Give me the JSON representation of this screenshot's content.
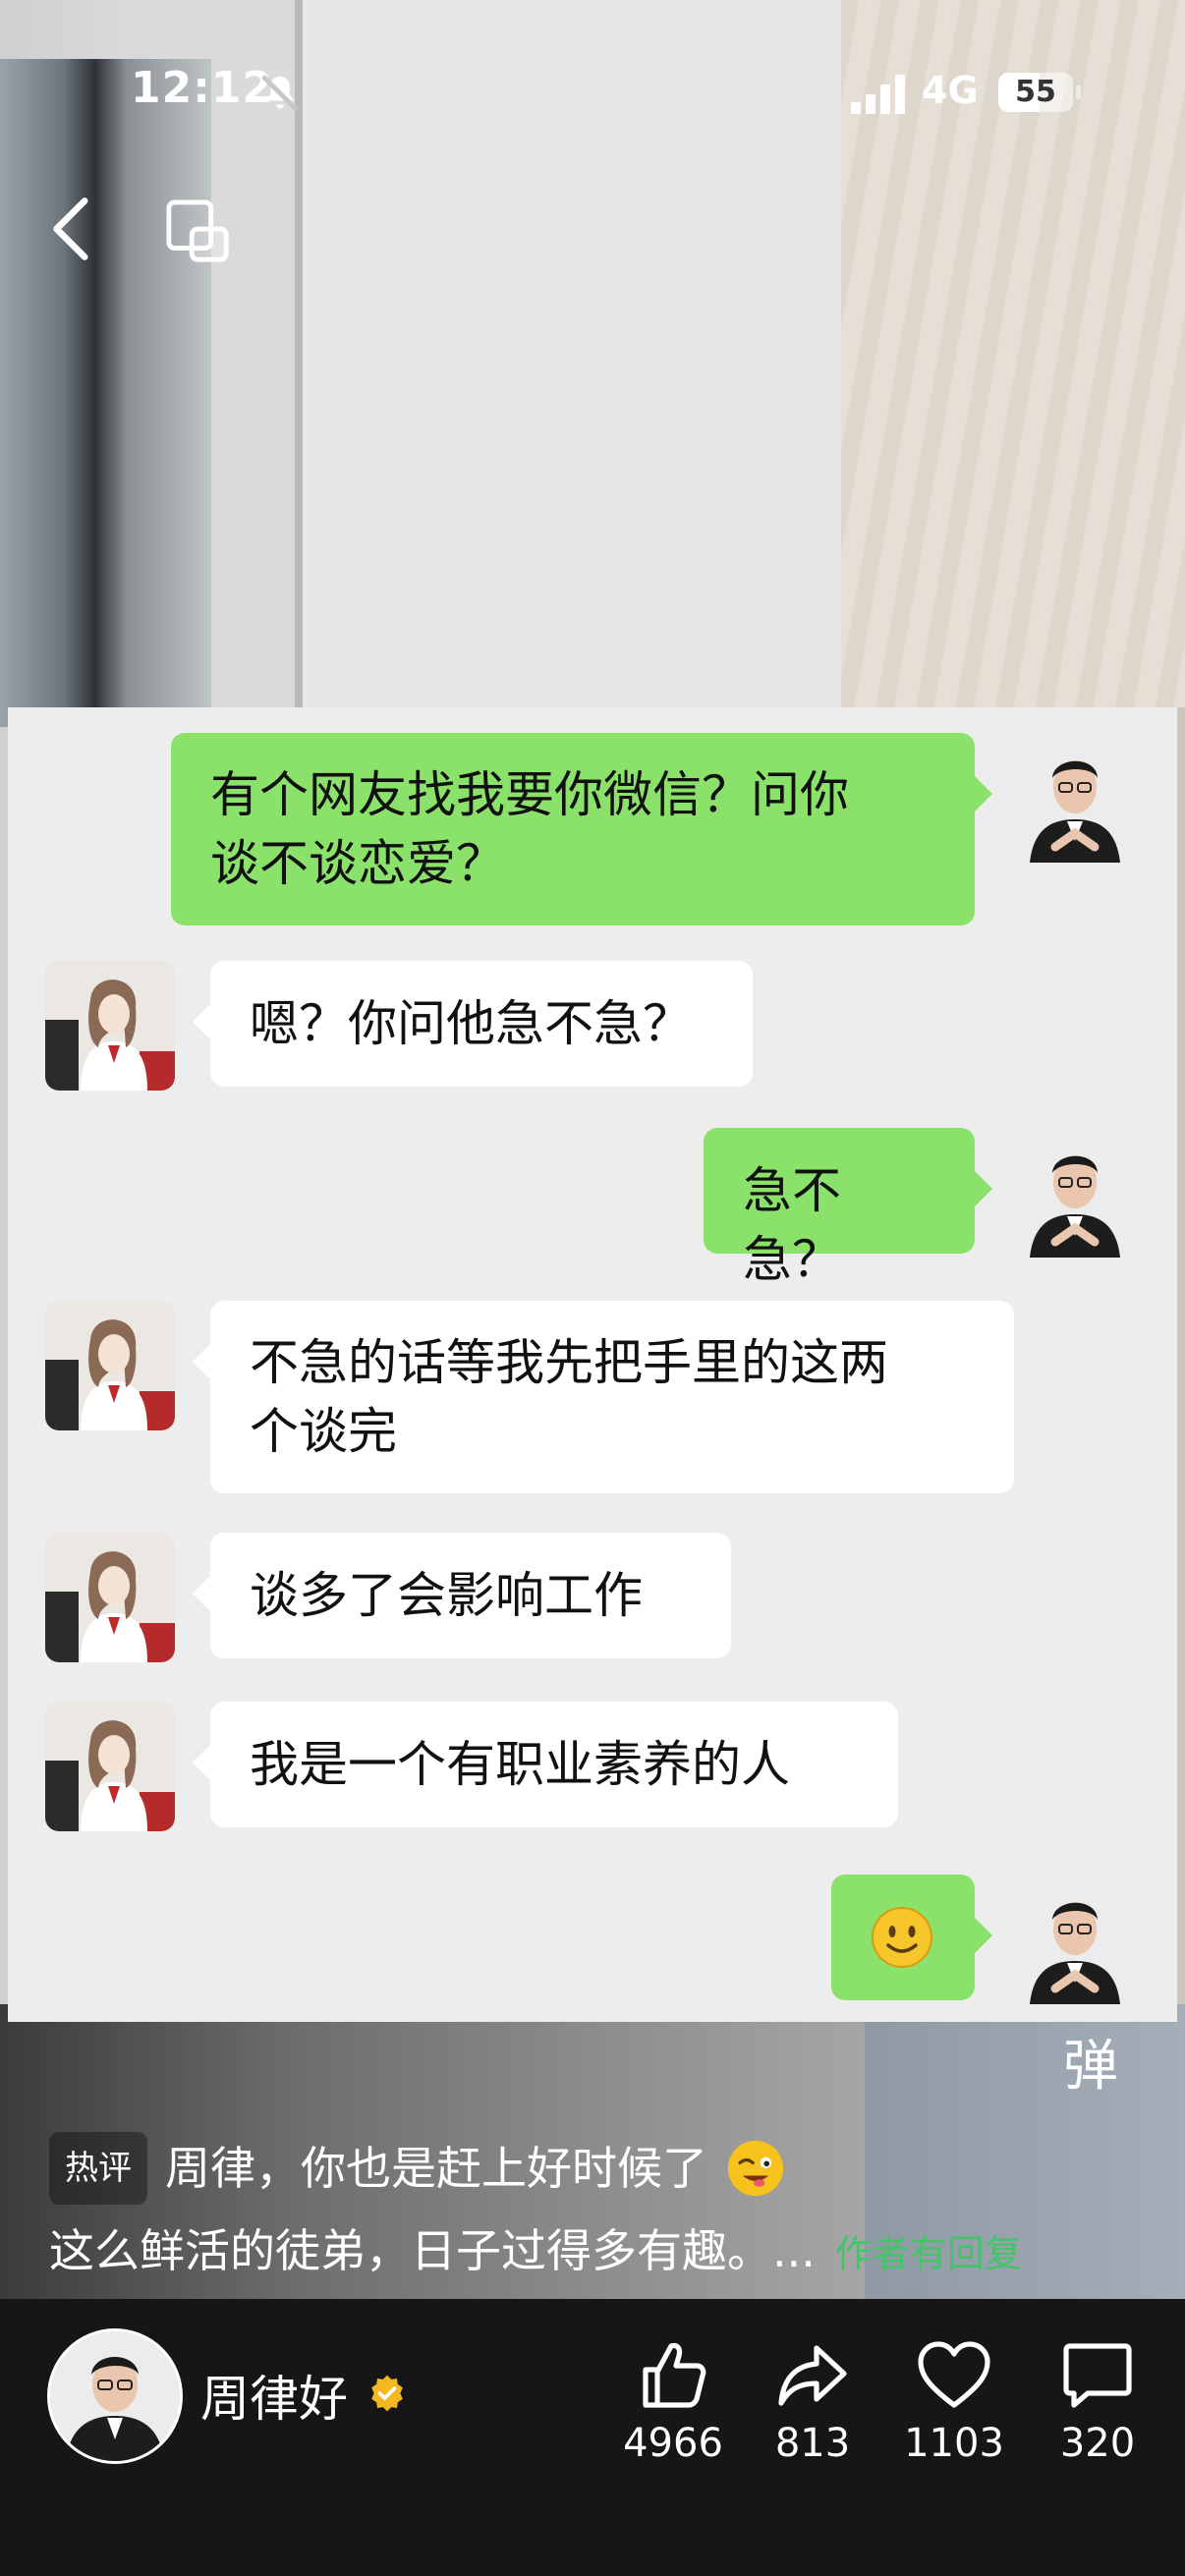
{
  "status_bar": {
    "time": "12:12",
    "network": "4G",
    "battery": "55",
    "battery_level": 0.55
  },
  "chat": {
    "messages": [
      {
        "side": "right",
        "lines": [
          "有个网友找我要你微信？问你",
          "谈不谈恋爱？"
        ]
      },
      {
        "side": "left",
        "lines": [
          "嗯？你问他急不急？"
        ]
      },
      {
        "side": "right",
        "lines": [
          "急不急？"
        ]
      },
      {
        "side": "left",
        "lines": [
          "不急的话等我先把手里的这两",
          "个谈完"
        ]
      },
      {
        "side": "left",
        "lines": [
          "谈多了会影响工作"
        ]
      },
      {
        "side": "left",
        "lines": [
          "我是一个有职业素养的人"
        ]
      },
      {
        "side": "right",
        "lines": [],
        "emoji": "smile"
      }
    ]
  },
  "danmu_toggle": "弹",
  "hot_comment": {
    "tag": "热评",
    "line1": "周律，你也是赶上好时候了",
    "line1_emoji": "wink",
    "line2": "这么鲜活的徒弟，日子过得多有趣。...",
    "reply_note": "作者有回复"
  },
  "author": {
    "name": "周律好",
    "verified": true
  },
  "actions": {
    "like": {
      "icon": "thumbs-up-icon",
      "count": "4966"
    },
    "share": {
      "icon": "share-icon",
      "count": "813"
    },
    "favorite": {
      "icon": "heart-icon",
      "count": "1103"
    },
    "comment": {
      "icon": "comment-icon",
      "count": "320"
    }
  },
  "colors": {
    "green_bubble": "#8be26b",
    "reply_green": "#45c36a",
    "bar_bg": "#161616"
  }
}
